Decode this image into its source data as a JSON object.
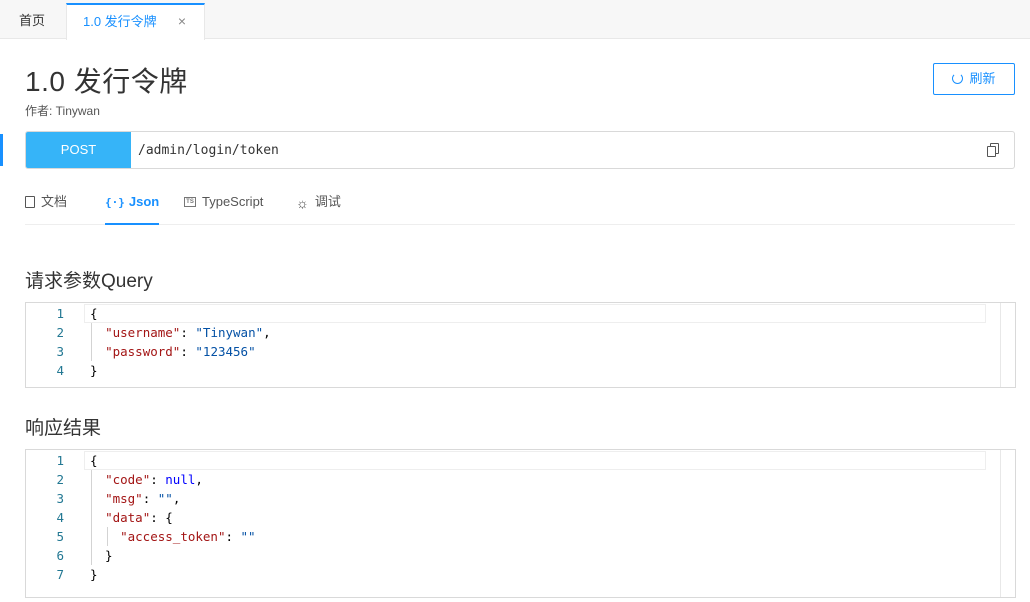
{
  "tabs": {
    "home_label": "首页",
    "active_label": "1.0 发行令牌",
    "close_glyph": "×"
  },
  "header": {
    "title": "1.0 发行令牌",
    "author": "作者: Tinywan",
    "refresh_label": "刷新"
  },
  "request": {
    "method": "POST",
    "url": "/admin/login/token"
  },
  "subtabs": {
    "doc": "文档",
    "json": "Json",
    "typescript": "TypeScript",
    "debug": "调试",
    "ts_badge": "TS"
  },
  "query_section": {
    "title": "请求参数Query",
    "lines": [
      {
        "n": "1",
        "parts": [
          [
            "{",
            "p"
          ]
        ]
      },
      {
        "n": "2",
        "parts": [
          [
            "  ",
            "p"
          ],
          [
            "\"username\"",
            "key"
          ],
          [
            ": ",
            "p"
          ],
          [
            "\"Tinywan\"",
            "str"
          ],
          [
            ",",
            "p"
          ]
        ]
      },
      {
        "n": "3",
        "parts": [
          [
            "  ",
            "p"
          ],
          [
            "\"password\"",
            "key"
          ],
          [
            ": ",
            "p"
          ],
          [
            "\"123456\"",
            "str"
          ]
        ]
      },
      {
        "n": "4",
        "parts": [
          [
            "}",
            "p"
          ]
        ]
      }
    ]
  },
  "response_section": {
    "title": "响应结果",
    "lines": [
      {
        "n": "1",
        "parts": [
          [
            "{",
            "p"
          ]
        ]
      },
      {
        "n": "2",
        "parts": [
          [
            "  ",
            "p"
          ],
          [
            "\"code\"",
            "key"
          ],
          [
            ": ",
            "p"
          ],
          [
            "null",
            "null"
          ],
          [
            ",",
            "p"
          ]
        ]
      },
      {
        "n": "3",
        "parts": [
          [
            "  ",
            "p"
          ],
          [
            "\"msg\"",
            "key"
          ],
          [
            ": ",
            "p"
          ],
          [
            "\"\"",
            "str"
          ],
          [
            ",",
            "p"
          ]
        ]
      },
      {
        "n": "4",
        "parts": [
          [
            "  ",
            "p"
          ],
          [
            "\"data\"",
            "key"
          ],
          [
            ": {",
            "p"
          ]
        ]
      },
      {
        "n": "5",
        "parts": [
          [
            "    ",
            "p"
          ],
          [
            "\"access_token\"",
            "key"
          ],
          [
            ": ",
            "p"
          ],
          [
            "\"\"",
            "str"
          ]
        ]
      },
      {
        "n": "6",
        "parts": [
          [
            "  }",
            "p"
          ]
        ]
      },
      {
        "n": "7",
        "parts": [
          [
            "}",
            "p"
          ]
        ]
      }
    ]
  },
  "colors": {
    "accent": "#1890ff",
    "method_bg": "#36b4f8",
    "json_key": "#a31515",
    "json_string": "#0451a5",
    "json_null": "#0000ff",
    "line_number": "#237893"
  }
}
